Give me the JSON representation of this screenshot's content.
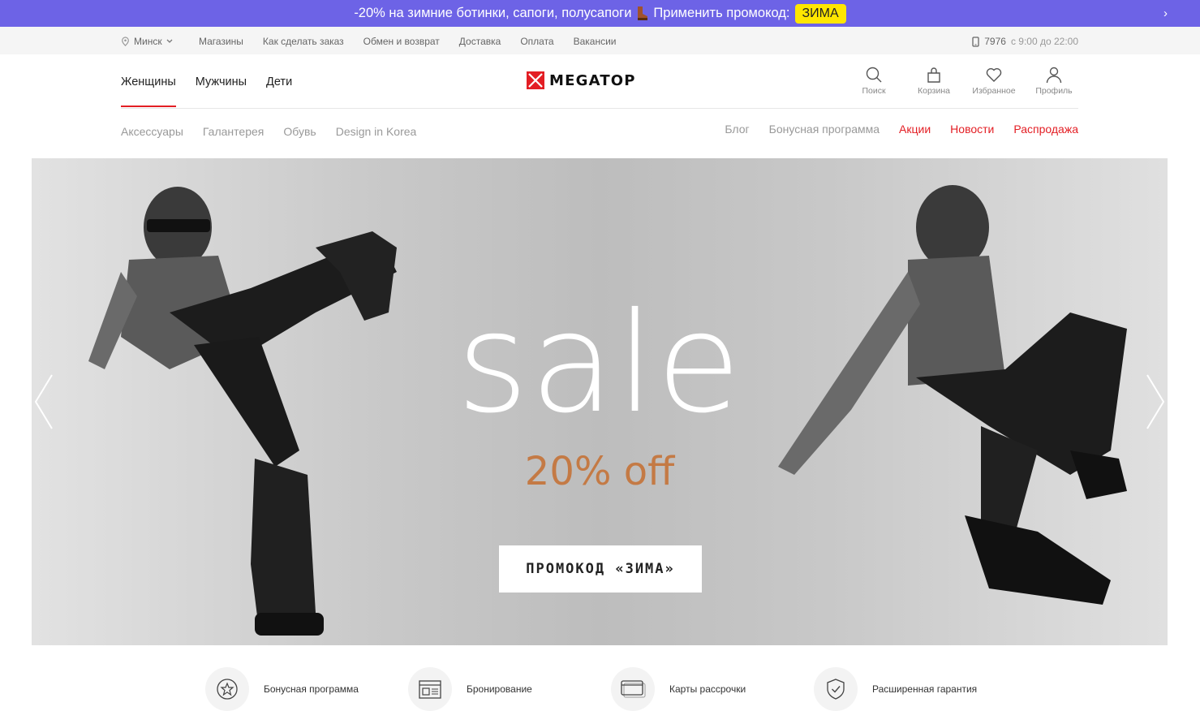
{
  "promo": {
    "text_before": "-20% на зимние ботинки, сапоги, полусапоги",
    "text_after": "Применить промокод:",
    "code": "ЗИМА",
    "colors": {
      "background": "#6d63e6",
      "code_bg": "#ffe600"
    }
  },
  "infobar": {
    "city": "Минск",
    "links": [
      "Магазины",
      "Как сделать заказ",
      "Обмен и возврат",
      "Доставка",
      "Оплата",
      "Вакансии"
    ],
    "phone": "7976",
    "hours": "с 9:00 до 22:00"
  },
  "header": {
    "gender_tabs": [
      "Женщины",
      "Мужчины",
      "Дети"
    ],
    "active_tab": "Женщины",
    "logo": "MEGATOP",
    "icons": [
      {
        "name": "search-icon",
        "label": "Поиск"
      },
      {
        "name": "cart-icon",
        "label": "Корзина"
      },
      {
        "name": "heart-icon",
        "label": "Избранное"
      },
      {
        "name": "user-icon",
        "label": "Профиль"
      }
    ]
  },
  "catnav": {
    "left": [
      "Аксессуары",
      "Галантерея",
      "Обувь",
      "Design in Korea"
    ],
    "right": [
      {
        "label": "Блог",
        "highlight": false
      },
      {
        "label": "Бонусная программа",
        "highlight": false
      },
      {
        "label": "Акции",
        "highlight": true
      },
      {
        "label": "Новости",
        "highlight": true
      },
      {
        "label": "Распродажа",
        "highlight": true
      }
    ],
    "accent_color": "#e31e24"
  },
  "hero": {
    "headline": "sale",
    "subline": "20% off",
    "cta": "ПРОМОКОД «ЗИМА»",
    "subline_color": "#c47a45"
  },
  "features": [
    {
      "icon": "star-badge-icon",
      "label": "Бонусная программа"
    },
    {
      "icon": "calendar-booking-icon",
      "label": "Бронирование"
    },
    {
      "icon": "credit-card-icon",
      "label": "Карты рассрочки"
    },
    {
      "icon": "shield-check-icon",
      "label": "Расширенная гарантия"
    }
  ]
}
